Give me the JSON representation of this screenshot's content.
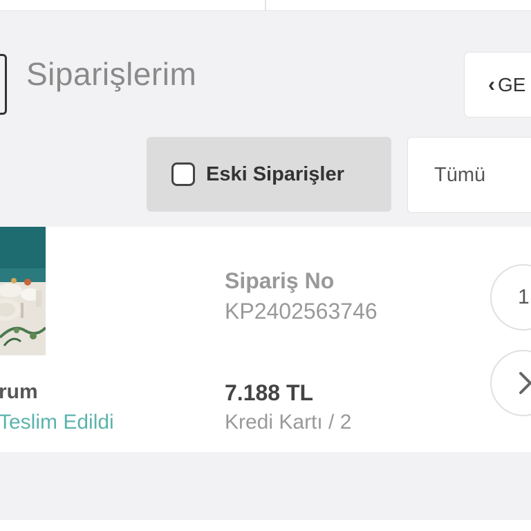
{
  "header": {
    "title": "Siparişlerim",
    "back_label": "GE"
  },
  "filters": {
    "old_orders_label": "Eski Siparişler",
    "old_orders_checked": false,
    "status_selected": "Tümü"
  },
  "order": {
    "product_name_partial": "rum",
    "status": "Teslim Edildi",
    "order_no_label": "Sipariş No",
    "order_no": "KP2402563746",
    "price": "7.188 TL",
    "payment": "Kredi Kartı / 2",
    "quantity": "1",
    "status_color": "#5cb3ac"
  },
  "icons": {
    "back": "chevron-left-icon",
    "detail": "chevron-right-icon",
    "menu": "menu-icon"
  }
}
